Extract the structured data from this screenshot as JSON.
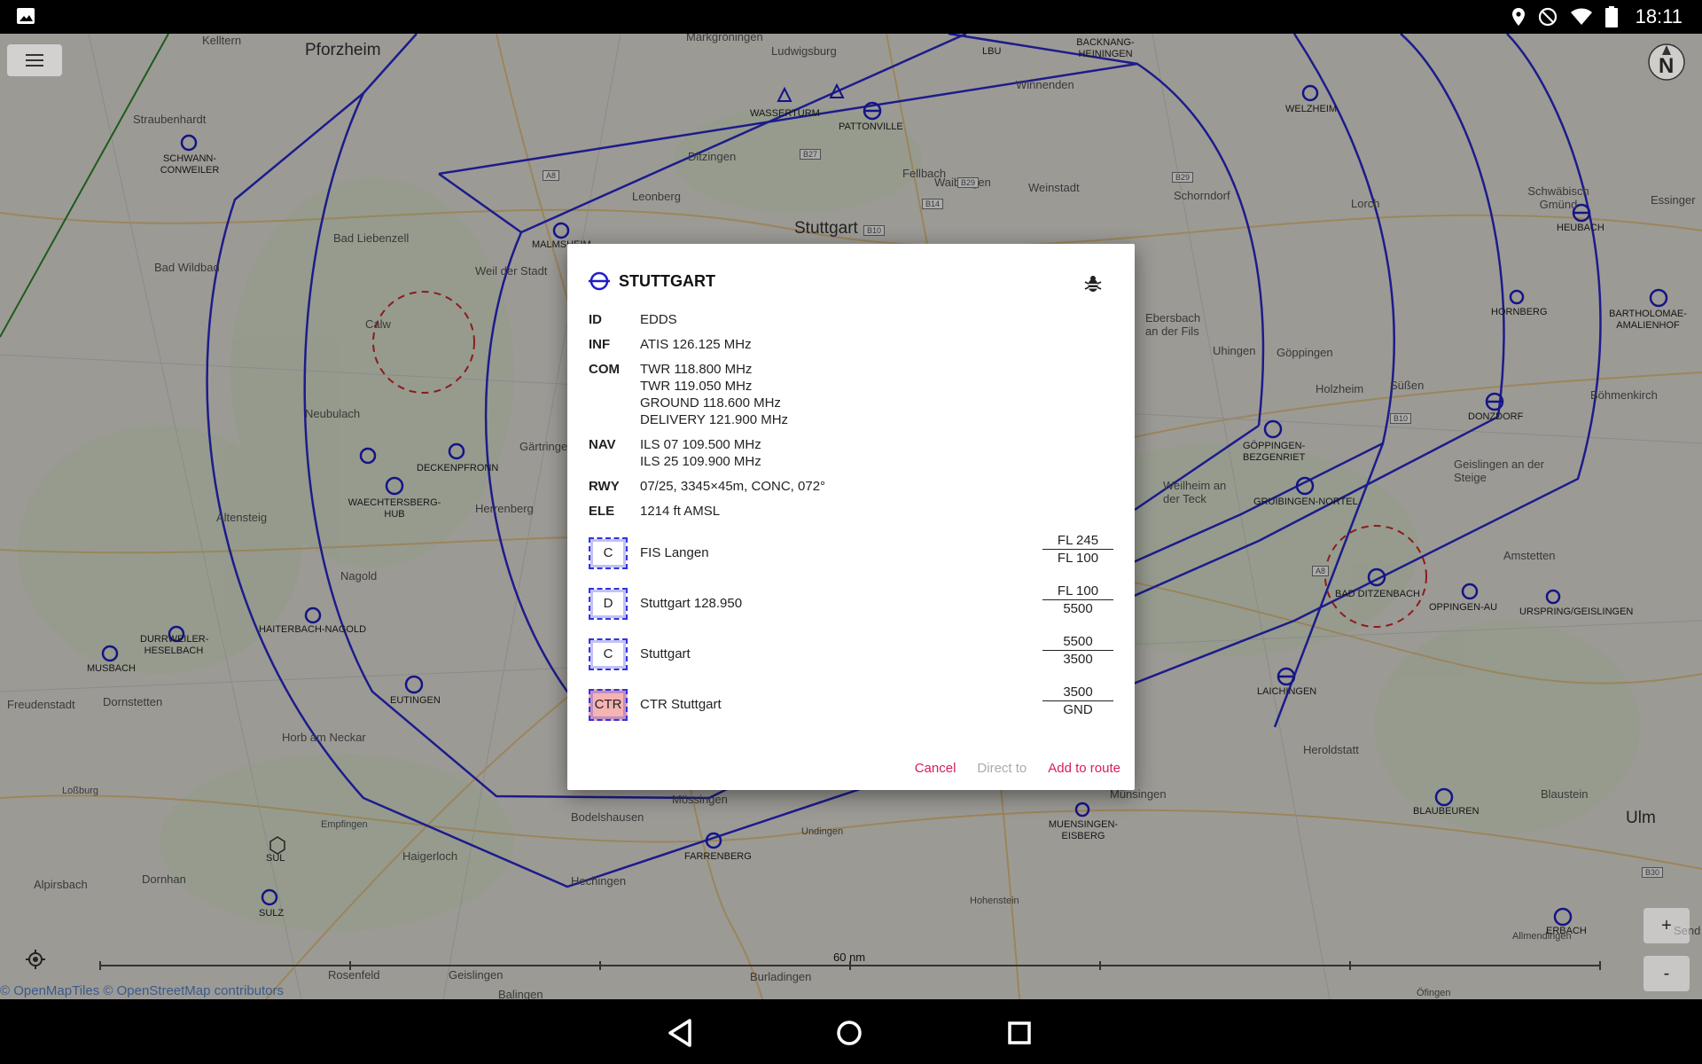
{
  "status_bar": {
    "time": "18:11",
    "icons": [
      "image-icon",
      "location-icon",
      "do-not-disturb-icon",
      "wifi-icon",
      "battery-icon"
    ]
  },
  "map": {
    "place_labels": [
      "Pforzheim",
      "Kelltern",
      "Markgröningen",
      "Ludwigsburg",
      "LBU",
      "BACKNANG-HEININGEN",
      "Straubenhardt",
      "SCHWANN-CONWEILER",
      "WASSERTURM",
      "PATTONVILLE",
      "Winnenden",
      "WELZHEIM",
      "Ditzingen",
      "Waiblingen",
      "Fellbach",
      "Weinstadt",
      "Schorndorf",
      "Lorch",
      "Schwäbisch Gmünd",
      "HEUBACH",
      "Essinger",
      "Leonberg",
      "Stuttgart",
      "Bad Liebenzell",
      "MALMSHEIM",
      "Weil der Stadt",
      "Bad Wildbad",
      "Calw",
      "Ebersbach an der Fils",
      "Uhingen",
      "Göppingen",
      "HORNBERG",
      "BARTHOLOMAE-AMALIENHOF",
      "Neubulach",
      "Holzheim",
      "Süßen",
      "DONZDORF",
      "Böhmenkirch",
      "DECKENPFRONN",
      "Gärtringen",
      "GÖPPINGEN-BEZGENRIET",
      "WAECHTERSBERG-HUB",
      "Herrenberg",
      "Altensteig",
      "Weilheim an der Teck",
      "GRUIBINGEN-NORTEL",
      "Geislingen an der Steige",
      "Nagold",
      "BAD DITZENBACH",
      "Amstetten",
      "OPPINGEN-AU",
      "URSPRING/GEISLINGEN",
      "DURRWEILER-HESELBACH",
      "HAITERBACH-NAGOLD",
      "MUSBACH",
      "EUTINGEN",
      "LAICHINGEN",
      "Freudenstadt",
      "Dornstetten",
      "Horb am Neckar",
      "Heroldstatt",
      "Loßburg",
      "Mössingen",
      "Bodelshausen",
      "Münsingen",
      "BLAUBEUREN",
      "Blaustein",
      "Ulm",
      "Empfingen",
      "SUL",
      "Haigerloch",
      "FARRENBERG",
      "Undingen",
      "MUENSINGEN-EISBERG",
      "Alpirsbach",
      "Dornhan",
      "Hechingen",
      "Hohenstein",
      "SULZ",
      "ERBACH",
      "Allmendingen",
      "Rosenfeld",
      "Geislingen",
      "Burladingen",
      "Öfingen",
      "Balingen",
      "Send"
    ],
    "road_labels": [
      "A8",
      "B27",
      "B29",
      "B14",
      "B10",
      "B29",
      "B10",
      "A8",
      "B30"
    ],
    "scale_label": "60 nm",
    "attribution": "© OpenMapTiles © OpenStreetMap contributors",
    "compass_letter": "N",
    "zoom_in": "+",
    "zoom_out": "-"
  },
  "dialog": {
    "title": "STUTTGART",
    "title_icon": "airport-icon",
    "info": {
      "id_key": "ID",
      "id_value": "EDDS",
      "inf_key": "INF",
      "inf_value": "ATIS 126.125 MHz",
      "com_key": "COM",
      "com_values": [
        "TWR 118.800 MHz",
        "TWR 119.050 MHz",
        "GROUND 118.600 MHz",
        "DELIVERY 121.900 MHz"
      ],
      "nav_key": "NAV",
      "nav_values": [
        "ILS 07 109.500 MHz",
        "ILS 25 109.900 MHz"
      ],
      "rwy_key": "RWY",
      "rwy_value": "07/25, 3345×45m, CONC, 072°",
      "ele_key": "ELE",
      "ele_value": "1214 ft AMSL"
    },
    "airspaces": [
      {
        "class": "C",
        "name": "FIS Langen",
        "upper": "FL 245",
        "lower": "FL 100",
        "color": "#ffffff"
      },
      {
        "class": "D",
        "name": "Stuttgart 128.950",
        "upper": "FL 100",
        "lower": "5500",
        "color": "#ffffff"
      },
      {
        "class": "C",
        "name": "Stuttgart",
        "upper": "5500",
        "lower": "3500",
        "color": "#ffffff"
      },
      {
        "class": "CTR",
        "name": "CTR Stuttgart",
        "upper": "3500",
        "lower": "GND",
        "color": "#f6b3b3"
      }
    ],
    "actions": {
      "cancel": "Cancel",
      "direct_to": "Direct to",
      "add_to_route": "Add to route"
    },
    "accent_color": "#d81b60"
  },
  "nav_bar": {
    "icons": [
      "back-icon",
      "home-icon",
      "recents-icon"
    ]
  }
}
